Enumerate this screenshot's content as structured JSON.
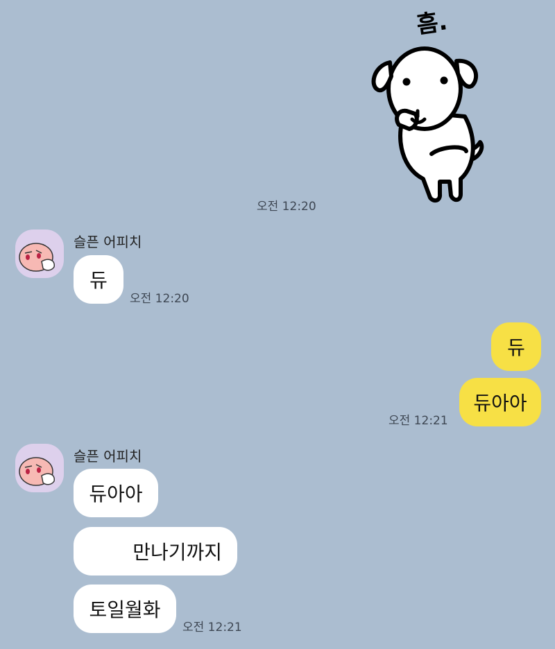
{
  "sticker": {
    "caption": "흠."
  },
  "messages": {
    "time_divider": "오전 12:20",
    "group1": {
      "sender": "슬픈 어피치",
      "text": "듀",
      "time": "오전 12:20"
    },
    "mine": {
      "msg1": "듀",
      "msg2": "듀아아",
      "time": "오전 12:21"
    },
    "group2": {
      "sender": "슬픈 어피치",
      "msg1": "듀아아",
      "msg2": "만나기까지",
      "msg3": "토일월화",
      "time": "오전 12:21"
    }
  },
  "colors": {
    "background": "#abbdd0",
    "incoming_bubble": "#ffffff",
    "outgoing_bubble": "#f7e045"
  }
}
